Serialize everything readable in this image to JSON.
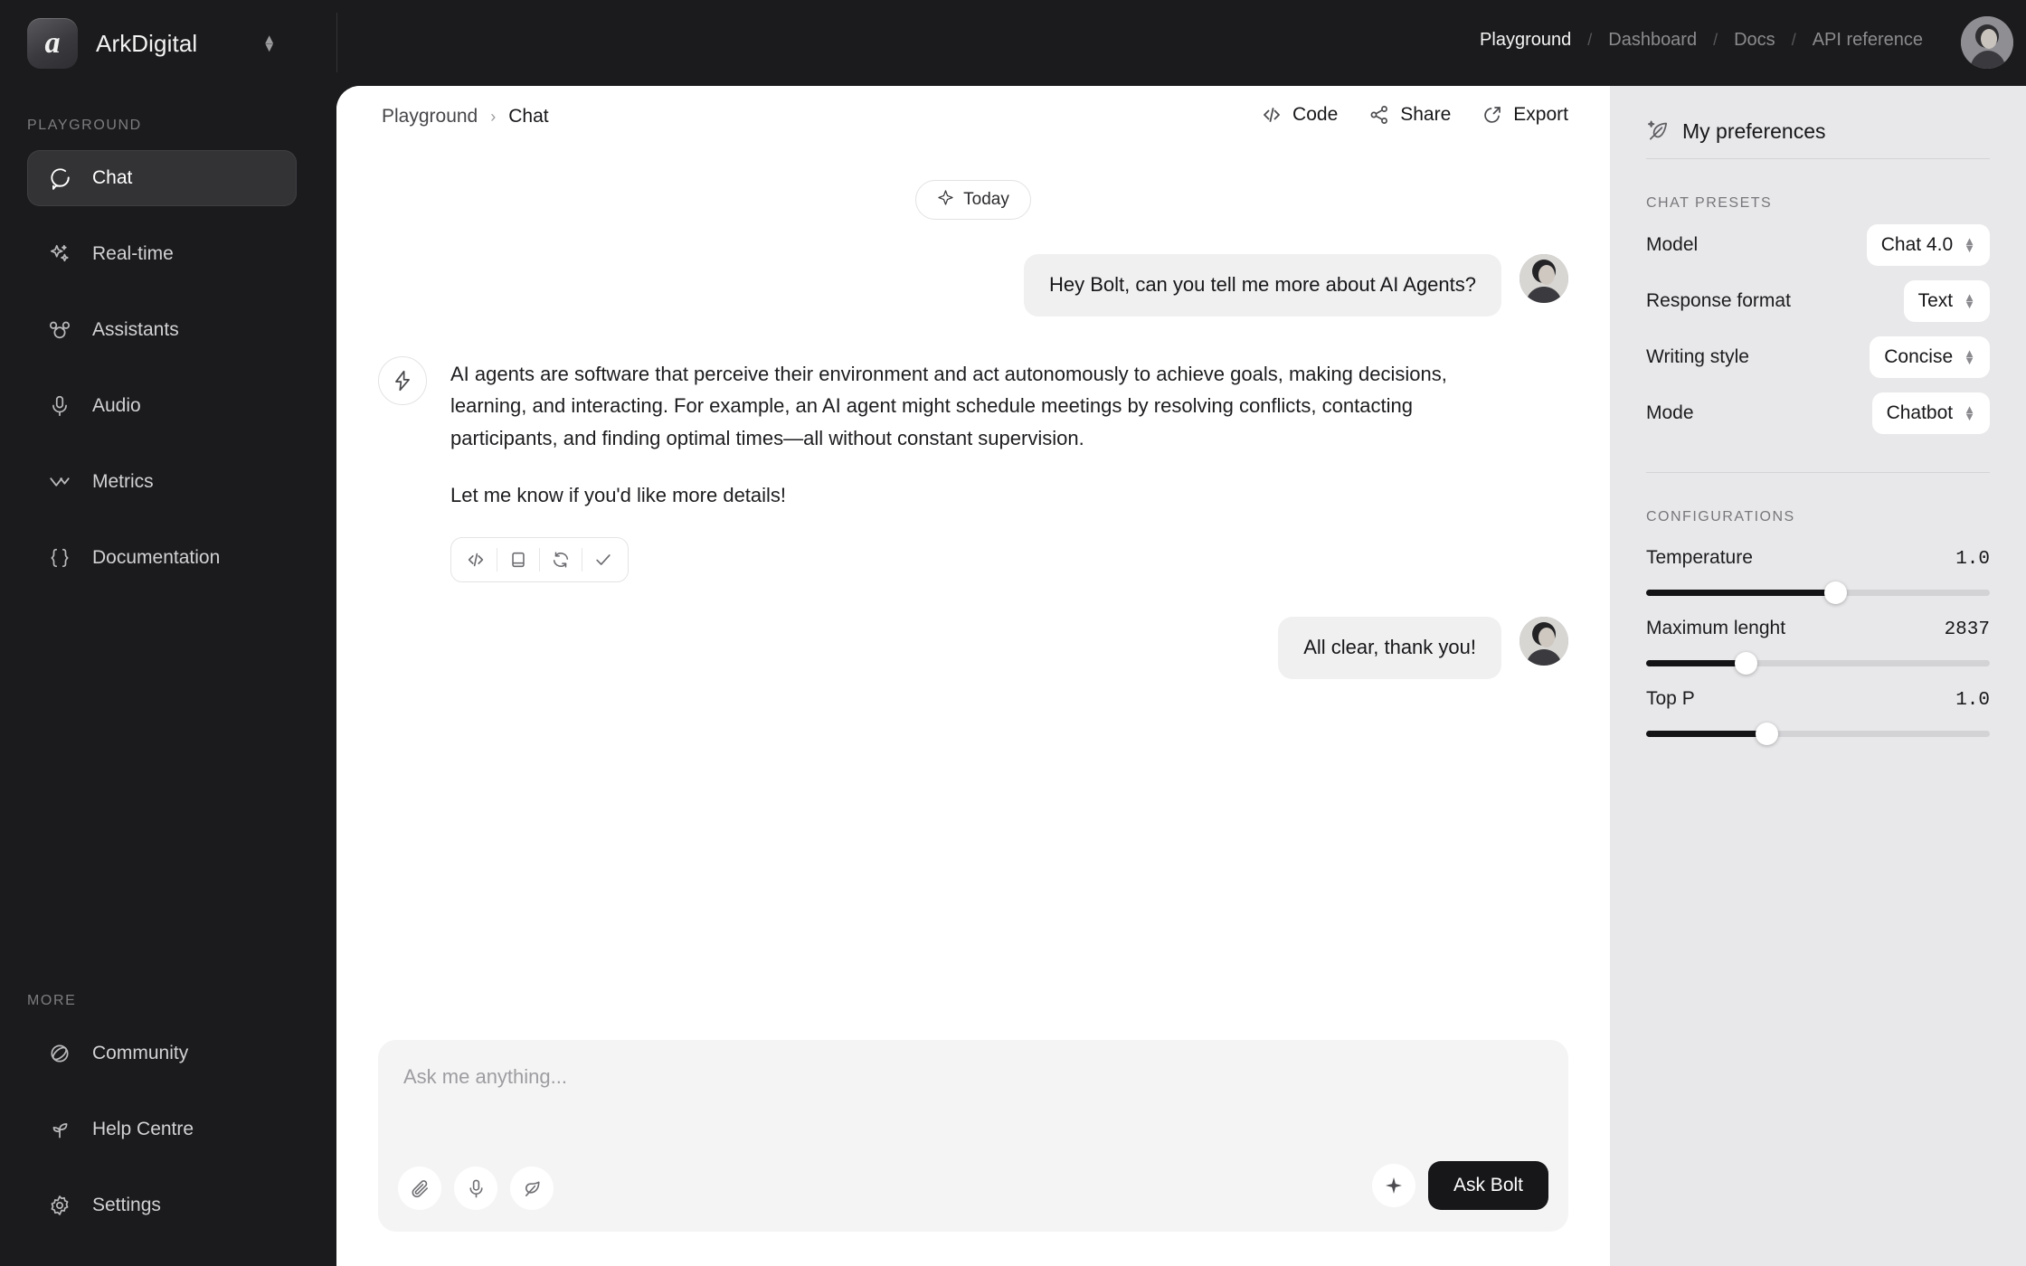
{
  "brand": {
    "name": "ArkDigital",
    "logo_glyph": "a"
  },
  "topnav": {
    "items": [
      {
        "label": "Playground",
        "active": true
      },
      {
        "label": "Dashboard",
        "active": false
      },
      {
        "label": "Docs",
        "active": false
      },
      {
        "label": "API reference",
        "active": false
      }
    ],
    "separator": "/"
  },
  "sidebar": {
    "section_playground": "PLAYGROUND",
    "section_more": "MORE",
    "items": [
      {
        "label": "Chat",
        "icon": "chat-bubble-icon",
        "active": true
      },
      {
        "label": "Real-time",
        "icon": "sparkles-icon",
        "active": false
      },
      {
        "label": "Assistants",
        "icon": "assistants-icon",
        "active": false
      },
      {
        "label": "Audio",
        "icon": "microphone-icon",
        "active": false
      },
      {
        "label": "Metrics",
        "icon": "chevrons-down-icon",
        "active": false
      },
      {
        "label": "Documentation",
        "icon": "braces-icon",
        "active": false
      }
    ],
    "more_items": [
      {
        "label": "Community",
        "icon": "globe-orbit-icon"
      },
      {
        "label": "Help Centre",
        "icon": "sprout-icon"
      },
      {
        "label": "Settings",
        "icon": "gear-icon"
      }
    ]
  },
  "breadcrumb": {
    "parent": "Playground",
    "separator": "›",
    "current": "Chat"
  },
  "head_actions": [
    {
      "label": "Code",
      "icon": "code-icon"
    },
    {
      "label": "Share",
      "icon": "share-nodes-icon"
    },
    {
      "label": "Export",
      "icon": "export-arrow-icon"
    }
  ],
  "thread": {
    "day_chip": "Today",
    "user_message_1": "Hey Bolt, can you tell me more about AI Agents?",
    "bot_paragraph_1": "AI agents are software that perceive their environment and act autonomously to achieve goals, making decisions, learning, and interacting. For example, an AI agent might schedule meetings by resolving conflicts, contacting participants, and finding optimal times—all without constant supervision.",
    "bot_paragraph_2": "Let me know if you'd like more details!",
    "message_tools": [
      "code-icon",
      "copy-icon",
      "regenerate-icon",
      "check-icon"
    ],
    "user_message_2": "All clear, thank you!"
  },
  "composer": {
    "placeholder": "Ask me anything...",
    "left_icons": [
      "attachment-icon",
      "microphone-icon",
      "leaf-icon"
    ],
    "spark_icon": "sparkle-icon",
    "submit_label": "Ask Bolt"
  },
  "preferences": {
    "title": "My preferences",
    "title_icon": "feather-sparkle-icon",
    "presets_label": "CHAT PRESETS",
    "presets": [
      {
        "label": "Model",
        "value": "Chat 4.0"
      },
      {
        "label": "Response format",
        "value": "Text"
      },
      {
        "label": "Writing style",
        "value": "Concise"
      },
      {
        "label": "Mode",
        "value": "Chatbot"
      }
    ],
    "configurations_label": "CONFIGURATIONS",
    "sliders": [
      {
        "label": "Temperature",
        "value": "1.0",
        "percent": 55
      },
      {
        "label": "Maximum lenght",
        "value": "2837",
        "percent": 29
      },
      {
        "label": "Top P",
        "value": "1.0",
        "percent": 35
      }
    ]
  },
  "colors": {
    "sidebar_bg": "#1b1b1d",
    "panel_bg": "#ffffff",
    "prefs_bg": "#e8e8ea",
    "accent_dark": "#17171a"
  }
}
